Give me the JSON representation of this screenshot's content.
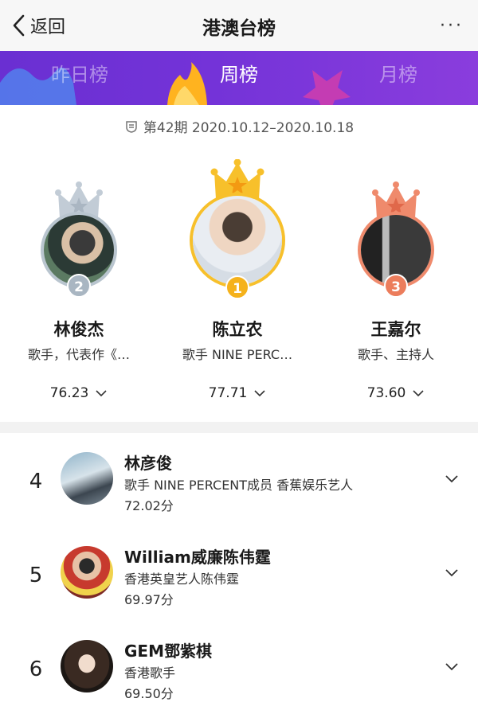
{
  "nav": {
    "back_label": "返回",
    "title": "港澳台榜",
    "more": "···"
  },
  "tabs": [
    {
      "label": "昨日榜",
      "active": false
    },
    {
      "label": "周榜",
      "active": true
    },
    {
      "label": "月榜",
      "active": false
    }
  ],
  "period": "第42期 2020.10.12–2020.10.18",
  "podium": [
    {
      "rank": "2",
      "name": "林俊杰",
      "desc": "歌手，代表作《…",
      "score": "76.23",
      "medal": "silver"
    },
    {
      "rank": "1",
      "name": "陈立农",
      "desc": "歌手 NINE PERC…",
      "score": "77.71",
      "medal": "gold"
    },
    {
      "rank": "3",
      "name": "王嘉尔",
      "desc": "歌手、主持人",
      "score": "73.60",
      "medal": "bronze"
    }
  ],
  "list": [
    {
      "rank": "4",
      "name": "林彦俊",
      "desc": "歌手 NINE PERCENT成员 香蕉娱乐艺人",
      "score": "72.02分"
    },
    {
      "rank": "5",
      "name": "William威廉陈伟霆",
      "desc": "香港英皇艺人陈伟霆",
      "score": "69.97分"
    },
    {
      "rank": "6",
      "name": "GEM鄧紫棋",
      "desc": "香港歌手",
      "score": "69.50分"
    }
  ],
  "colors": {
    "tab_bar": "#7433d8",
    "gold": "#f7c02b",
    "silver": "#b9c5cf",
    "bronze": "#ef8a6c"
  }
}
